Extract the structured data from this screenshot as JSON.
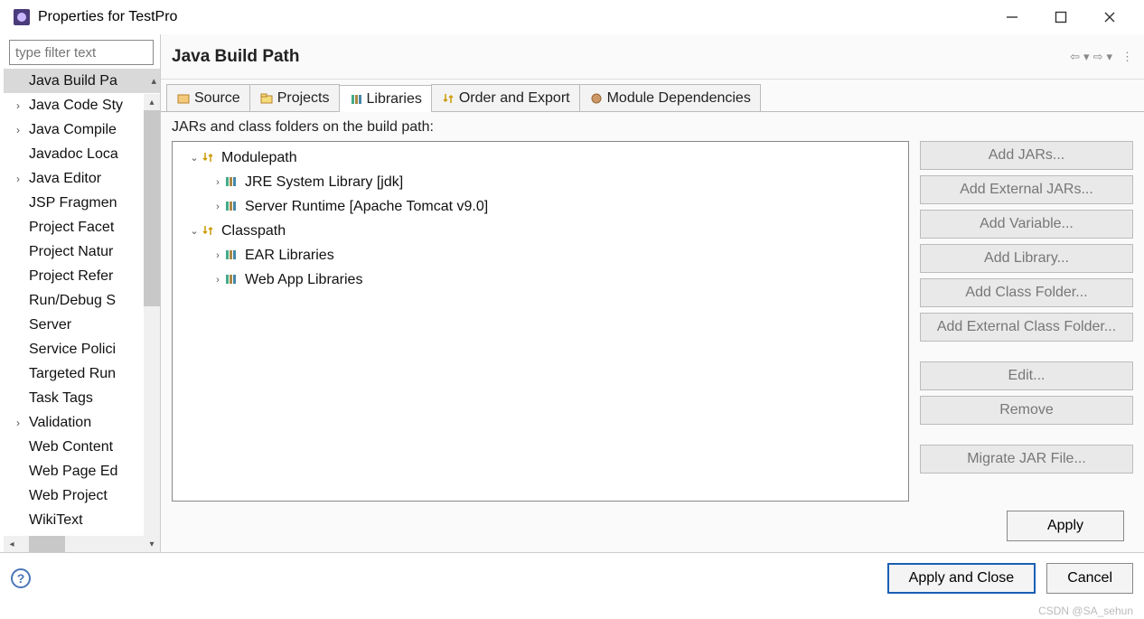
{
  "window": {
    "title": "Properties for TestPro"
  },
  "sidebar": {
    "filter_placeholder": "type filter text",
    "items": [
      {
        "label": "Java Build Pa",
        "expandable": false,
        "selected": true,
        "truncated": true
      },
      {
        "label": "Java Code Sty",
        "expandable": true
      },
      {
        "label": "Java Compile",
        "expandable": true
      },
      {
        "label": "Javadoc Loca",
        "expandable": false
      },
      {
        "label": "Java Editor",
        "expandable": true
      },
      {
        "label": "JSP Fragmen",
        "expandable": false
      },
      {
        "label": "Project Facet",
        "expandable": false
      },
      {
        "label": "Project Natur",
        "expandable": false
      },
      {
        "label": "Project Refer",
        "expandable": false
      },
      {
        "label": "Run/Debug S",
        "expandable": false
      },
      {
        "label": "Server",
        "expandable": false
      },
      {
        "label": "Service Polici",
        "expandable": false
      },
      {
        "label": "Targeted Run",
        "expandable": false
      },
      {
        "label": "Task Tags",
        "expandable": false
      },
      {
        "label": "Validation",
        "expandable": true
      },
      {
        "label": "Web Content",
        "expandable": false
      },
      {
        "label": "Web Page Ed",
        "expandable": false
      },
      {
        "label": "Web Project",
        "expandable": false
      },
      {
        "label": "WikiText",
        "expandable": false
      }
    ]
  },
  "page": {
    "title": "Java Build Path",
    "tabs": [
      {
        "label": "Source",
        "icon": "source-icon"
      },
      {
        "label": "Projects",
        "icon": "projects-icon"
      },
      {
        "label": "Libraries",
        "icon": "libraries-icon",
        "active": true
      },
      {
        "label": "Order and Export",
        "icon": "order-icon"
      },
      {
        "label": "Module Dependencies",
        "icon": "module-icon"
      }
    ],
    "description": "JARs and class folders on the build path:",
    "tree": [
      {
        "label": "Modulepath",
        "level": 1,
        "expanded": true,
        "kind": "group"
      },
      {
        "label": "JRE System Library [jdk]",
        "level": 2,
        "kind": "lib"
      },
      {
        "label": "Server Runtime [Apache Tomcat v9.0]",
        "level": 2,
        "kind": "lib"
      },
      {
        "label": "Classpath",
        "level": 1,
        "expanded": true,
        "kind": "group"
      },
      {
        "label": "EAR Libraries",
        "level": 2,
        "kind": "lib"
      },
      {
        "label": "Web App Libraries",
        "level": 2,
        "kind": "lib"
      }
    ],
    "buttons": {
      "add_jars": "Add JARs...",
      "add_ext_jars": "Add External JARs...",
      "add_variable": "Add Variable...",
      "add_library": "Add Library...",
      "add_class_folder": "Add Class Folder...",
      "add_ext_class_folder": "Add External Class Folder...",
      "edit": "Edit...",
      "remove": "Remove",
      "migrate": "Migrate JAR File...",
      "apply": "Apply"
    }
  },
  "footer": {
    "apply_close": "Apply and Close",
    "cancel": "Cancel"
  },
  "watermark": "CSDN @SA_sehun"
}
